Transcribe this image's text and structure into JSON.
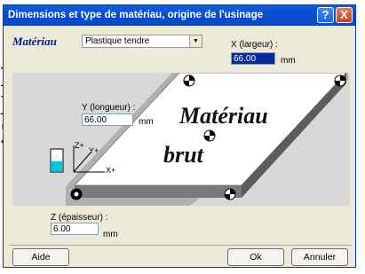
{
  "background_text": [
    "I",
    "X",
    "Z"
  ],
  "window": {
    "title": "Dimensions et type de matériau, origine de l'usinage",
    "help_label": "?",
    "close_label": "X"
  },
  "material": {
    "label": "Matériau",
    "selected": "Plastique tendre"
  },
  "x_field": {
    "label": "X (largeur) :",
    "value": "66.00",
    "unit": "mm"
  },
  "y_field": {
    "label": "Y (longueur) :",
    "value": "66.00",
    "unit": "mm"
  },
  "z_field": {
    "label": "Z (épaisseur) :",
    "value": "6.00",
    "unit": "mm"
  },
  "drawing": {
    "line1": "Matériau",
    "line2": "brut",
    "axes": {
      "z": "Z+",
      "y": "Y+",
      "x": "X+"
    }
  },
  "buttons": {
    "help": "Aide",
    "ok": "Ok",
    "cancel": "Annuler"
  },
  "colors": {
    "titlebar": "#0a4fd0",
    "accent_cyan": "#00c8dc"
  }
}
